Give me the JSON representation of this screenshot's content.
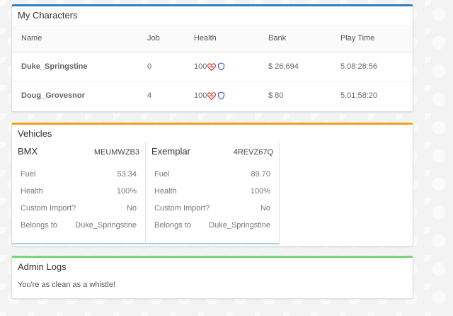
{
  "characters": {
    "title": "My Characters",
    "columns": [
      "Name",
      "Job",
      "Health",
      "Bank",
      "Play Time"
    ],
    "rows": [
      {
        "name": "Duke_Springstine",
        "job": "0",
        "health": "100",
        "bank": "$ 26,694",
        "play_time": "5.08:28:56"
      },
      {
        "name": "Doug_Grovesnor",
        "job": "4",
        "health": "100",
        "bank": "$ 80",
        "play_time": "5.01:58:20"
      }
    ],
    "icons": [
      "heart-icon",
      "shield-icon"
    ]
  },
  "vehicles": {
    "title": "Vehicles",
    "labels": {
      "fuel": "Fuel",
      "health": "Health",
      "custom_import": "Custom Import?",
      "belongs_to": "Belongs to"
    },
    "items": [
      {
        "model": "BMX",
        "plate": "MEUMWZB3",
        "fuel": "53.34",
        "health": "100%",
        "custom_import": "No",
        "belongs_to": "Duke_Springstine"
      },
      {
        "model": "Exemplar",
        "plate": "4REVZ67Q",
        "fuel": "89.70",
        "health": "100%",
        "custom_import": "No",
        "belongs_to": "Duke_Springstine"
      }
    ]
  },
  "admin_logs": {
    "title": "Admin Logs",
    "message": "You're as clean as a whistle!"
  },
  "colors": {
    "characters_accent": "#2f80c3",
    "vehicles_accent": "#f0a11c",
    "logs_accent": "#7ad67a",
    "heart": "#e0444b",
    "shield": "#4a5bd4"
  }
}
